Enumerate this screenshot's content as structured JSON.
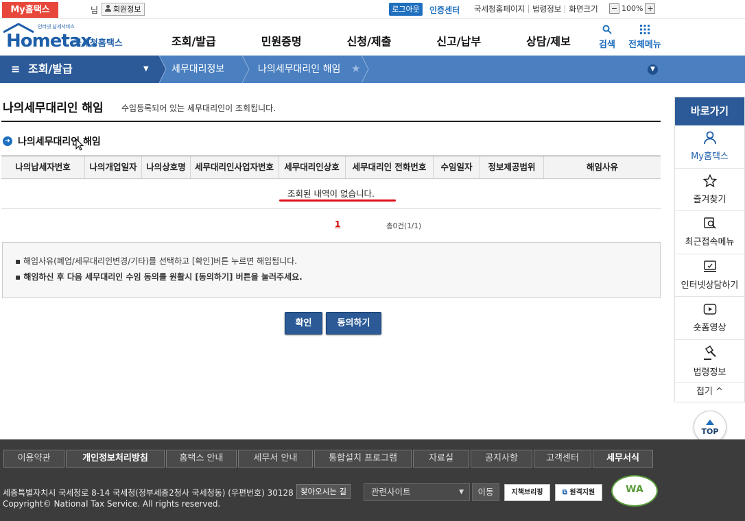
{
  "util": {
    "myhome_tab": "My홈택스",
    "nim": "님",
    "member_info": "회원정보",
    "logout": "로그아웃",
    "cert_center": "인증센터",
    "links": [
      "국세청홈페이지",
      "법령정보",
      "화면크기"
    ],
    "zoom_minus": "−",
    "zoom_value": "100%",
    "zoom_plus": "+"
  },
  "logo": {
    "tagline": "인터넷 납세서비스",
    "main": "Hometax.",
    "kor": "국세청홈택스"
  },
  "gnb": [
    "조회/발급",
    "민원증명",
    "신청/제출",
    "신고/납부",
    "상담/제보"
  ],
  "tools": {
    "search": "검색",
    "allmenu": "전체메뉴"
  },
  "breadcrumb": {
    "level1": "조회/발급",
    "level2": "세무대리정보",
    "level3": "나의세무대리인 해임"
  },
  "page": {
    "title": "나의세무대리인 해임",
    "desc": "수임등록되어 있는 세무대리인이 조회됩니다.",
    "section_title": "나의세무대리인 해임"
  },
  "table": {
    "headers": [
      "나의납세자번호",
      "나의개업일자",
      "나의상호명",
      "세무대리인사업자번호",
      "세무대리인상호",
      "세무대리인 전화번호",
      "수임일자",
      "정보제공범위",
      "해임사유"
    ],
    "empty_message": "조회된 내역이 없습니다."
  },
  "pagination": {
    "current": "1",
    "summary": "총0건(1/1)"
  },
  "info": {
    "line1": "해임사유(폐업/세무대리인변경/기타)를 선택하고 [확인]버튼 누르면 해임됩니다.",
    "line2": "해임하신 후 다음 세무대리인 수임 동의를 원활시 [동의하기] 버튼을 눌러주세요."
  },
  "buttons": {
    "confirm": "확인",
    "agree": "동의하기"
  },
  "quick": {
    "title": "바로가기",
    "items": [
      "My홈택스",
      "즐겨찾기",
      "최근접속메뉴",
      "인터넷상담하기",
      "숏폼영상",
      "법령정보"
    ],
    "fold": "접기 ^",
    "top": "TOP"
  },
  "footer": {
    "menu": [
      "이용약관",
      "개인정보처리방침",
      "홈택스 안내",
      "세무서 안내",
      "통합설치 프로그램",
      "자료실",
      "공지사항",
      "고객센터",
      "세무서식"
    ],
    "address": "세종특별자치시 국세청로 8-14 국세청(정부세종2청사 국세청동) (우편번호) 30128",
    "find_way": "찾아오시는 길",
    "copyright": "Copyright© National Tax Service. All rights reserved.",
    "related_site": "관련사이트",
    "go": "이동",
    "badge1": "지책브리핑",
    "badge2": "원격지원",
    "wa_mark": "WA"
  },
  "colors": {
    "primary": "#2c5a98",
    "accent_red": "#e8483b",
    "footer_bg": "#3c3c3c"
  }
}
